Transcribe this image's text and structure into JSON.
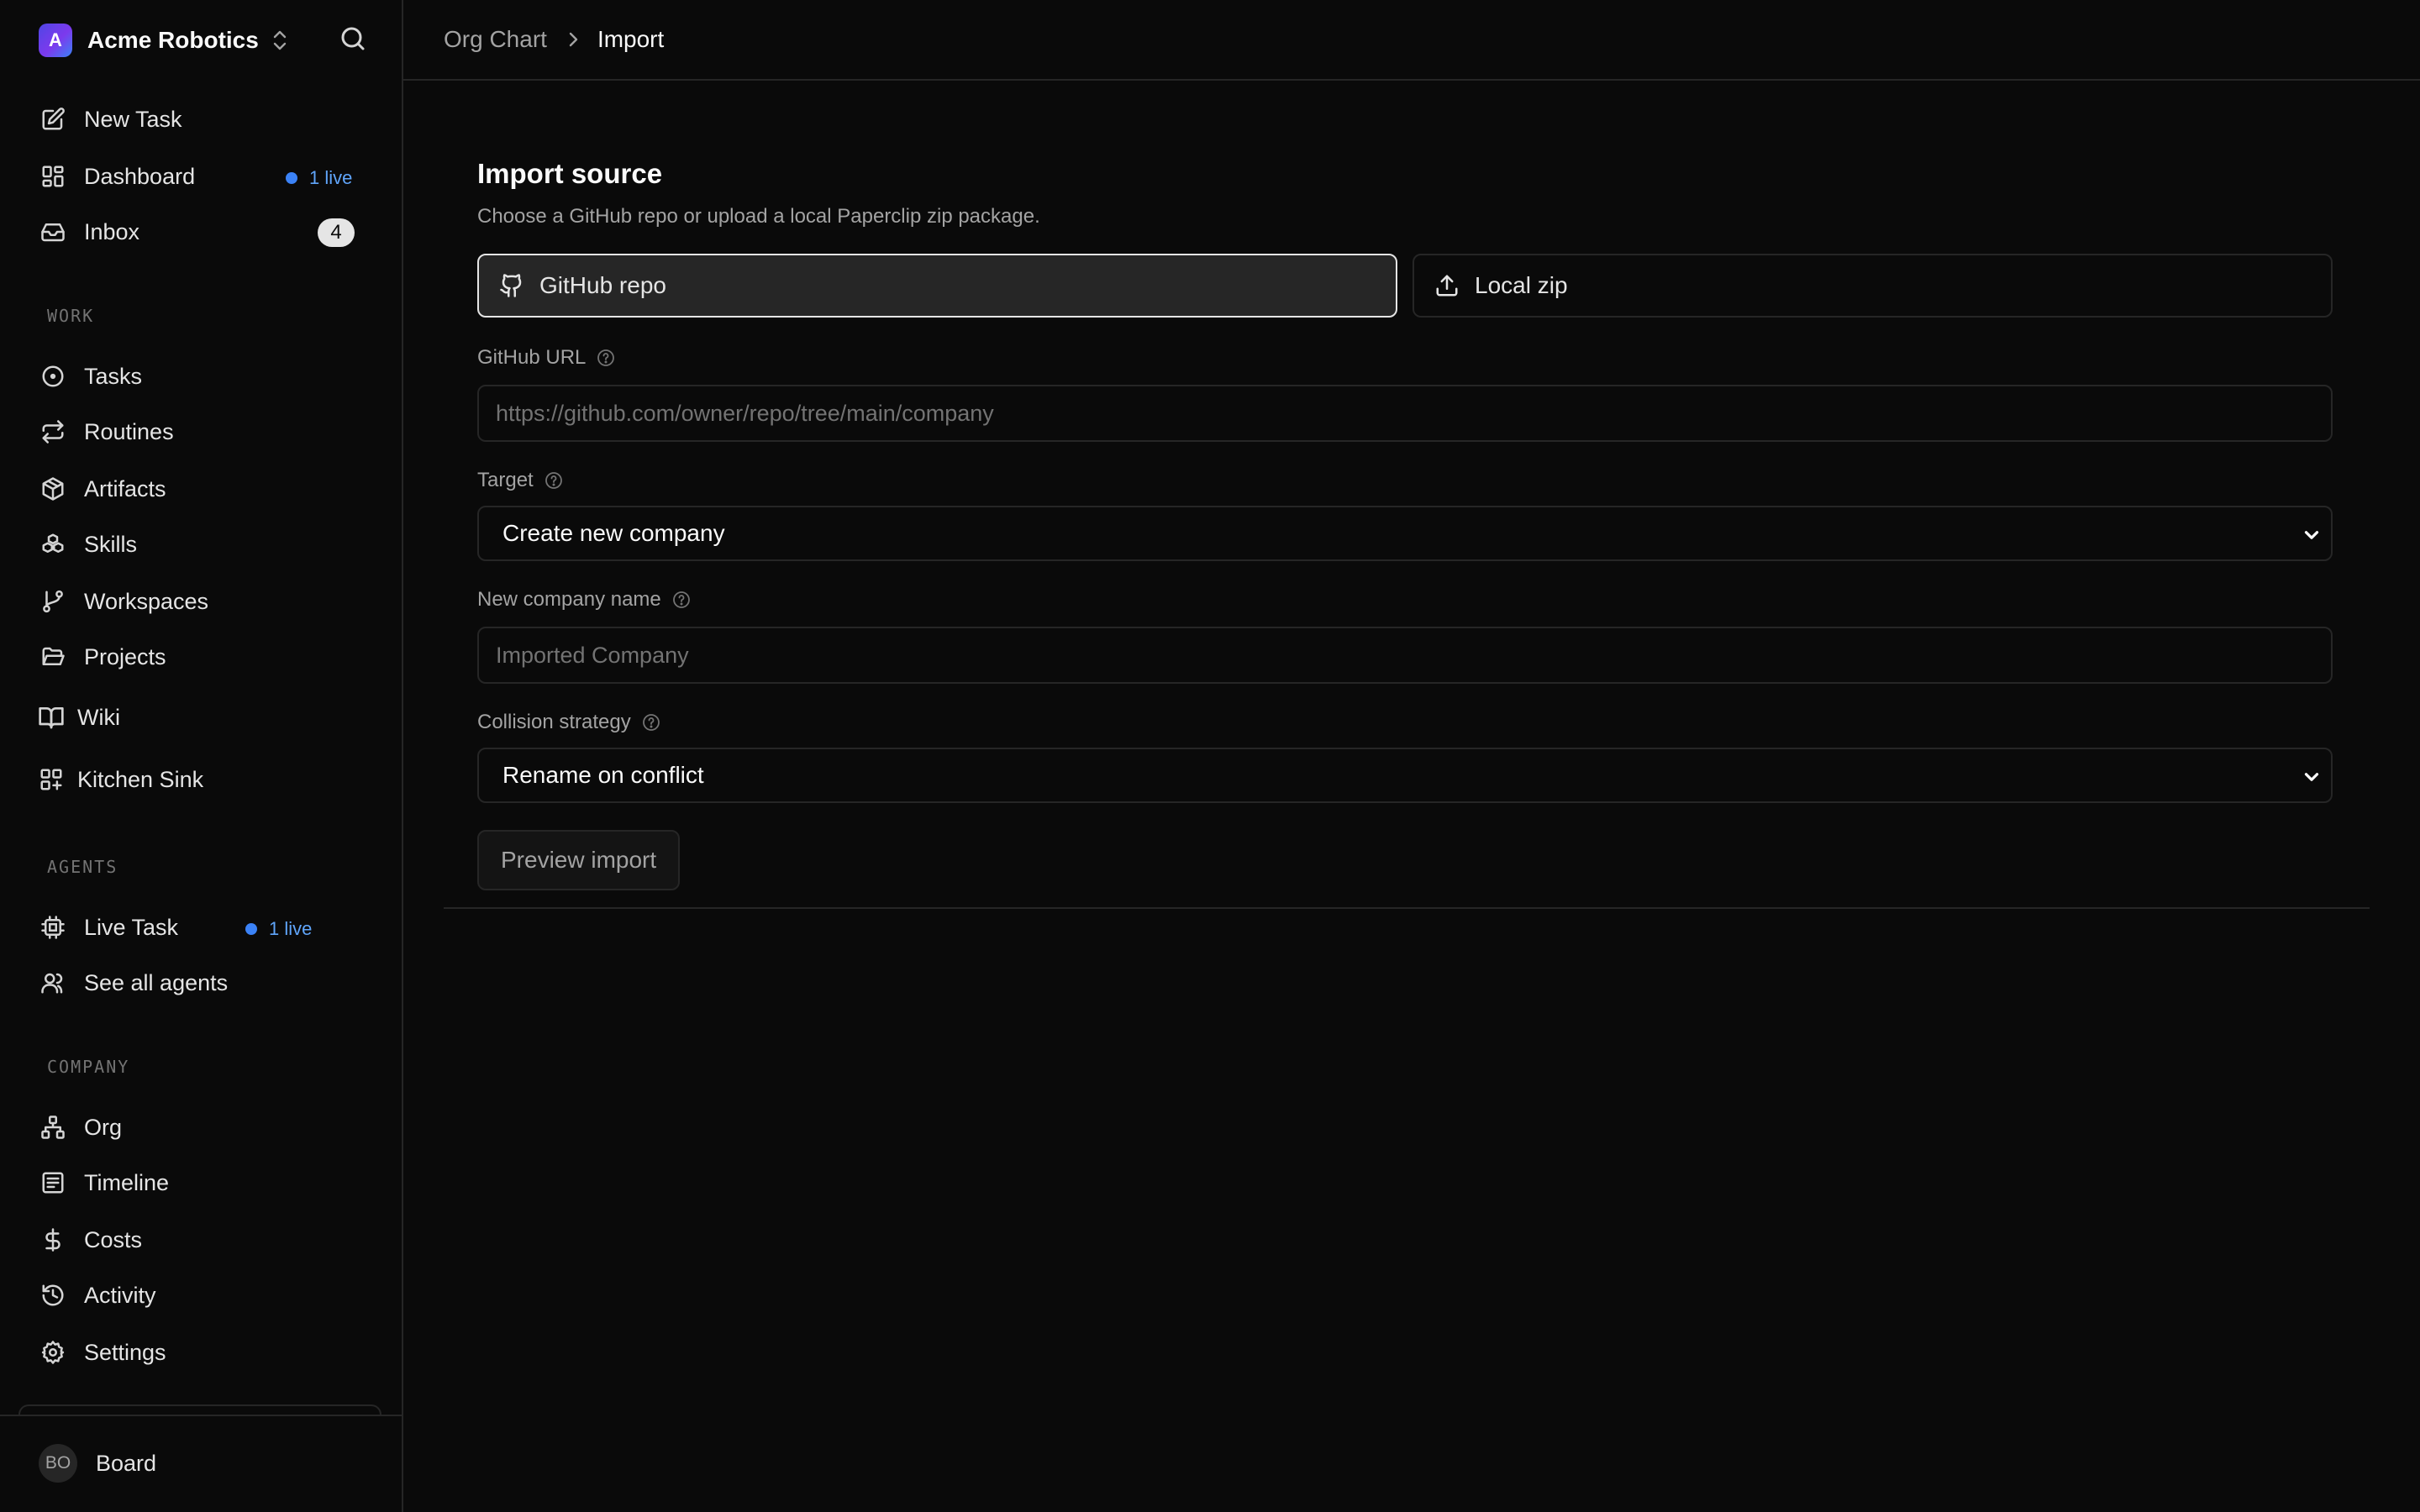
{
  "sidebar": {
    "company": {
      "initial": "A",
      "name": "Acme Robotics"
    },
    "top_items": [
      {
        "label": "New Task",
        "icon": "pencil-square-icon"
      },
      {
        "label": "Dashboard",
        "icon": "dashboard-icon",
        "badge": "1 live"
      },
      {
        "label": "Inbox",
        "icon": "inbox-icon",
        "count": "4"
      }
    ],
    "sections": {
      "work": "WORK",
      "agents": "AGENTS",
      "company": "COMPANY"
    },
    "work_items": [
      {
        "label": "Tasks",
        "icon": "circle-dot-icon"
      },
      {
        "label": "Routines",
        "icon": "repeat-icon"
      },
      {
        "label": "Artifacts",
        "icon": "package-icon"
      },
      {
        "label": "Skills",
        "icon": "boxes-icon"
      },
      {
        "label": "Workspaces",
        "icon": "git-branch-icon"
      },
      {
        "label": "Projects",
        "icon": "folder-open-icon"
      }
    ],
    "extra_items": [
      {
        "label": "Wiki",
        "icon": "book-open-icon"
      },
      {
        "label": "Kitchen Sink",
        "icon": "grid-plus-icon"
      }
    ],
    "agent_items": [
      {
        "label": "Live Task",
        "icon": "cpu-icon",
        "badge": "1 live"
      },
      {
        "label": "See all agents",
        "icon": "users-icon"
      }
    ],
    "company_items": [
      {
        "label": "Org",
        "icon": "network-icon"
      },
      {
        "label": "Timeline",
        "icon": "list-document-icon"
      },
      {
        "label": "Costs",
        "icon": "dollar-icon"
      },
      {
        "label": "Activity",
        "icon": "history-icon"
      },
      {
        "label": "Settings",
        "icon": "gear-icon"
      }
    ],
    "user": {
      "initials": "BO",
      "name": "Board"
    }
  },
  "breadcrumb": {
    "parent": "Org Chart",
    "current": "Import"
  },
  "import": {
    "title": "Import source",
    "subtitle": "Choose a GitHub repo or upload a local Paperclip zip package.",
    "sources": [
      {
        "label": "GitHub repo",
        "icon": "github-icon",
        "selected": true
      },
      {
        "label": "Local zip",
        "icon": "upload-icon",
        "selected": false
      }
    ],
    "github_url": {
      "label": "GitHub URL",
      "value": "",
      "placeholder": "https://github.com/owner/repo/tree/main/company"
    },
    "target": {
      "label": "Target",
      "selected": "Create new company"
    },
    "company_name": {
      "label": "New company name",
      "value": "",
      "placeholder": "Imported Company"
    },
    "collision": {
      "label": "Collision strategy",
      "selected": "Rename on conflict"
    },
    "preview_button": "Preview import"
  },
  "colors": {
    "background": "#0a0a0a",
    "border": "#262626",
    "accent_blue": "#3b82f6",
    "muted_text": "#a3a3a3"
  }
}
